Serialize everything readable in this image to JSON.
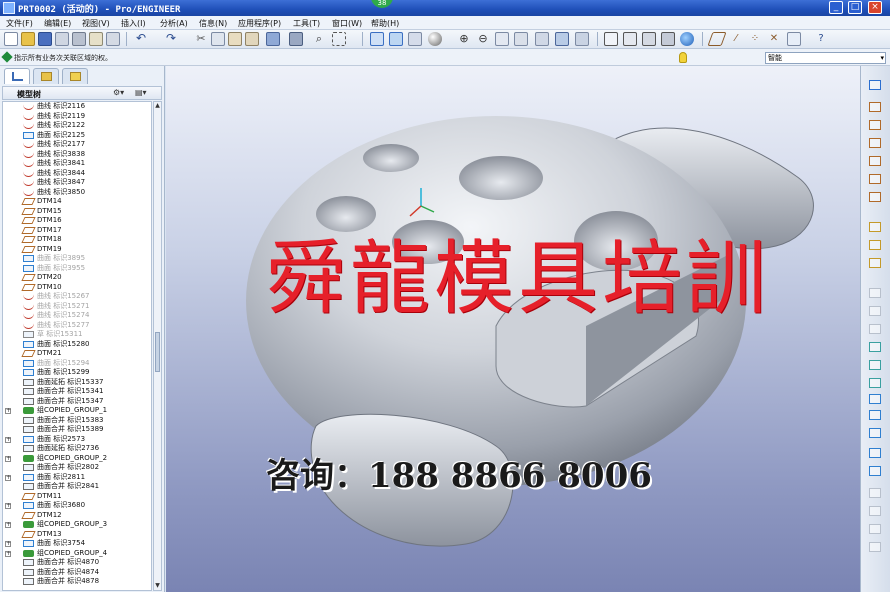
{
  "window": {
    "title": "PRT0002 (活动的) - Pro/ENGINEER",
    "badge": "38"
  },
  "menu": [
    {
      "id": "file",
      "label": "文件(F)"
    },
    {
      "id": "edit",
      "label": "编辑(E)"
    },
    {
      "id": "view",
      "label": "视图(V)"
    },
    {
      "id": "insert",
      "label": "插入(I)"
    },
    {
      "id": "analysis",
      "label": "分析(A)"
    },
    {
      "id": "info",
      "label": "信息(N)"
    },
    {
      "id": "applications",
      "label": "应用程序(P)"
    },
    {
      "id": "tools",
      "label": "工具(T)"
    },
    {
      "id": "window",
      "label": "窗口(W)"
    },
    {
      "id": "help",
      "label": "帮助(H)"
    }
  ],
  "message": {
    "text": "指示所有业务次关联区域的权。",
    "filter_value": "智能"
  },
  "model_tree": {
    "title": "模型树",
    "items": [
      {
        "label": "曲线 标识2116",
        "icon": "curve",
        "dim": false,
        "exp": false
      },
      {
        "label": "曲线 标识2119",
        "icon": "curve",
        "dim": false,
        "exp": false
      },
      {
        "label": "曲线 标识2122",
        "icon": "curve",
        "dim": false,
        "exp": false
      },
      {
        "label": "曲面 标识2125",
        "icon": "surface",
        "dim": false,
        "exp": false
      },
      {
        "label": "曲线 标识2177",
        "icon": "curve",
        "dim": false,
        "exp": false
      },
      {
        "label": "曲线 标识3838",
        "icon": "curve",
        "dim": false,
        "exp": false
      },
      {
        "label": "曲线 标识3841",
        "icon": "curve",
        "dim": false,
        "exp": false
      },
      {
        "label": "曲线 标识3844",
        "icon": "curve",
        "dim": false,
        "exp": false
      },
      {
        "label": "曲线 标识3847",
        "icon": "curve",
        "dim": false,
        "exp": false
      },
      {
        "label": "曲线 标识3850",
        "icon": "curve",
        "dim": false,
        "exp": false
      },
      {
        "label": "DTM14",
        "icon": "datum",
        "dim": false,
        "exp": false
      },
      {
        "label": "DTM15",
        "icon": "datum",
        "dim": false,
        "exp": false
      },
      {
        "label": "DTM16",
        "icon": "datum",
        "dim": false,
        "exp": false
      },
      {
        "label": "DTM17",
        "icon": "datum",
        "dim": false,
        "exp": false
      },
      {
        "label": "DTM18",
        "icon": "datum",
        "dim": false,
        "exp": false
      },
      {
        "label": "DTM19",
        "icon": "datum",
        "dim": false,
        "exp": false
      },
      {
        "label": "曲面 标识3895",
        "icon": "surface",
        "dim": true,
        "exp": false
      },
      {
        "label": "曲面 标识3955",
        "icon": "surface",
        "dim": true,
        "exp": false
      },
      {
        "label": "DTM20",
        "icon": "datum",
        "dim": false,
        "exp": false
      },
      {
        "label": "DTM10",
        "icon": "datum",
        "dim": false,
        "exp": false
      },
      {
        "label": "曲线 标识15267",
        "icon": "curve",
        "dim": true,
        "exp": false
      },
      {
        "label": "曲线 标识15271",
        "icon": "curve",
        "dim": true,
        "exp": false
      },
      {
        "label": "曲线 标识15274",
        "icon": "curve",
        "dim": true,
        "exp": false
      },
      {
        "label": "曲线 标识15277",
        "icon": "curve",
        "dim": true,
        "exp": false
      },
      {
        "label": "草 标识15311",
        "icon": "sketch",
        "dim": true,
        "exp": false
      },
      {
        "label": "曲面 标识15280",
        "icon": "surface",
        "dim": false,
        "exp": false
      },
      {
        "label": "DTM21",
        "icon": "datum",
        "dim": false,
        "exp": false
      },
      {
        "label": "曲面 标识15294",
        "icon": "surface",
        "dim": true,
        "exp": false
      },
      {
        "label": "曲面 标识15299",
        "icon": "surface",
        "dim": false,
        "exp": false
      },
      {
        "label": "曲面延拓 标识15337",
        "icon": "extend",
        "dim": false,
        "exp": false
      },
      {
        "label": "曲面合并 标识15341",
        "icon": "merge",
        "dim": false,
        "exp": false
      },
      {
        "label": "曲面合并 标识15347",
        "icon": "merge",
        "dim": false,
        "exp": false
      },
      {
        "label": "组COPIED_GROUP_1",
        "icon": "group",
        "dim": false,
        "exp": true
      },
      {
        "label": "曲面合并 标识15383",
        "icon": "merge",
        "dim": false,
        "exp": false
      },
      {
        "label": "曲面合并 标识15389",
        "icon": "merge",
        "dim": false,
        "exp": false
      },
      {
        "label": "曲面 标识2573",
        "icon": "surface",
        "dim": false,
        "exp": true
      },
      {
        "label": "曲面延拓 标识2736",
        "icon": "extend",
        "dim": false,
        "exp": false
      },
      {
        "label": "组COPIED_GROUP_2",
        "icon": "group",
        "dim": false,
        "exp": true
      },
      {
        "label": "曲面合并 标识2802",
        "icon": "merge",
        "dim": false,
        "exp": false
      },
      {
        "label": "曲面 标识2811",
        "icon": "surface",
        "dim": false,
        "exp": true
      },
      {
        "label": "曲面合并 标识2841",
        "icon": "merge",
        "dim": false,
        "exp": false
      },
      {
        "label": "DTM11",
        "icon": "datum",
        "dim": false,
        "exp": false
      },
      {
        "label": "曲面 标识3680",
        "icon": "surface",
        "dim": false,
        "exp": true
      },
      {
        "label": "DTM12",
        "icon": "datum",
        "dim": false,
        "exp": false
      },
      {
        "label": "组COPIED_GROUP_3",
        "icon": "group",
        "dim": false,
        "exp": true
      },
      {
        "label": "DTM13",
        "icon": "datum",
        "dim": false,
        "exp": false
      },
      {
        "label": "曲面 标识3754",
        "icon": "surface",
        "dim": false,
        "exp": true
      },
      {
        "label": "组COPIED_GROUP_4",
        "icon": "group",
        "dim": false,
        "exp": true
      },
      {
        "label": "曲面合并 标识4870",
        "icon": "merge",
        "dim": false,
        "exp": false
      },
      {
        "label": "曲面合并 标识4874",
        "icon": "merge",
        "dim": false,
        "exp": false
      },
      {
        "label": "曲面合并 标识4878",
        "icon": "merge",
        "dim": false,
        "exp": false
      }
    ]
  },
  "overlay": {
    "watermark": "舜龍模具培訓",
    "contact": "咨询：188 8866 8006"
  },
  "colors": {
    "titlebar": "#1f4fb8",
    "watermark": "#e6202a",
    "model": "#c3c7cf"
  },
  "icons": {
    "curve": "#c0392b",
    "surface": "#2f7fd0",
    "datum": "#b06a2a",
    "merge": "#6a6a6a",
    "extend": "#6a6a6a",
    "group": "#3a9a3a",
    "sketch": "#888888"
  }
}
